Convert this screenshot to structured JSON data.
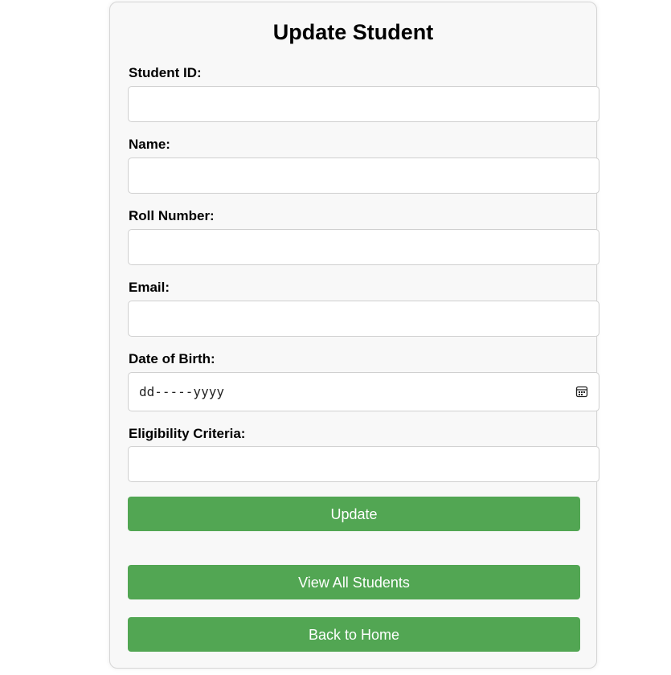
{
  "form": {
    "title": "Update Student",
    "fields": [
      {
        "label": "Student ID:",
        "value": ""
      },
      {
        "label": "Name:",
        "value": ""
      },
      {
        "label": "Roll Number:",
        "value": ""
      },
      {
        "label": "Email:",
        "value": ""
      },
      {
        "label": "Date of Birth:",
        "placeholder": "dd-----yyyy"
      },
      {
        "label": "Eligibility Criteria:",
        "value": ""
      }
    ],
    "update_label": "Update"
  },
  "nav": {
    "view_all_label": "View All Students",
    "back_home_label": "Back to Home"
  },
  "colors": {
    "button": "#52a653",
    "card_bg": "#f8f8f8"
  },
  "icons": {
    "date_picker": "calendar-icon"
  }
}
